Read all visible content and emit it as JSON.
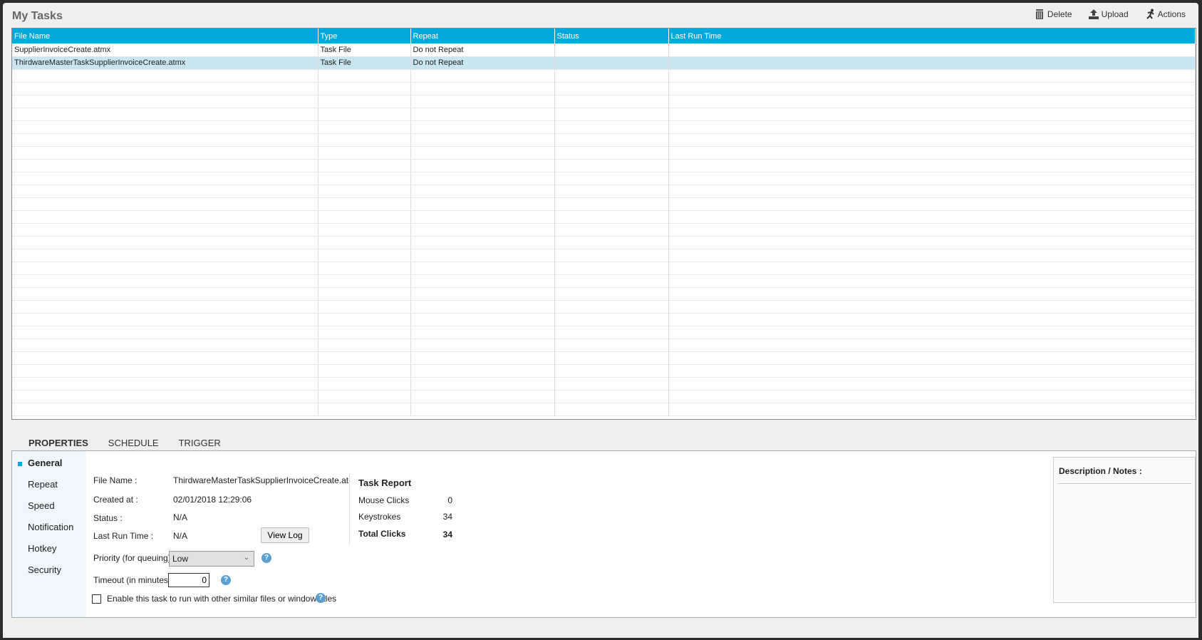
{
  "title": "My Tasks",
  "toolbar": {
    "delete": "Delete",
    "upload": "Upload",
    "actions": "Actions"
  },
  "table": {
    "columns": [
      "File Name",
      "Type",
      "Repeat",
      "Status",
      "Last Run Time"
    ],
    "rows": [
      [
        "SupplierInvoiceCreate.atmx",
        "Task File",
        "Do not Repeat",
        "",
        ""
      ],
      [
        "ThirdwareMasterTaskSupplierInvoiceCreate.atmx",
        "Task File",
        "Do not Repeat",
        "",
        ""
      ]
    ]
  },
  "tabs": [
    "PROPERTIES",
    "SCHEDULE",
    "TRIGGER"
  ],
  "nav": [
    "General",
    "Repeat",
    "Speed",
    "Notification",
    "Hotkey",
    "Security"
  ],
  "general": {
    "file_name_label": "File Name :",
    "file_name": "ThirdwareMasterTaskSupplierInvoiceCreate.at",
    "created_label": "Created at :",
    "created": "02/01/2018 12:29:06",
    "status_label": "Status :",
    "status": "N/A",
    "last_run_label": "Last Run Time :",
    "last_run": "N/A",
    "view_log": "View Log",
    "priority_label": "Priority (for queuing) :",
    "priority": "Low",
    "timeout_label": "Timeout (in minutes) :",
    "timeout": "0",
    "enable_label": "Enable this task to run with other similar files or window titles"
  },
  "report": {
    "title": "Task Report",
    "mouse_label": "Mouse Clicks",
    "mouse": "0",
    "keys_label": "Keystrokes",
    "keys": "34",
    "total_label": "Total Clicks",
    "total": "34"
  },
  "description_label": "Description / Notes :"
}
